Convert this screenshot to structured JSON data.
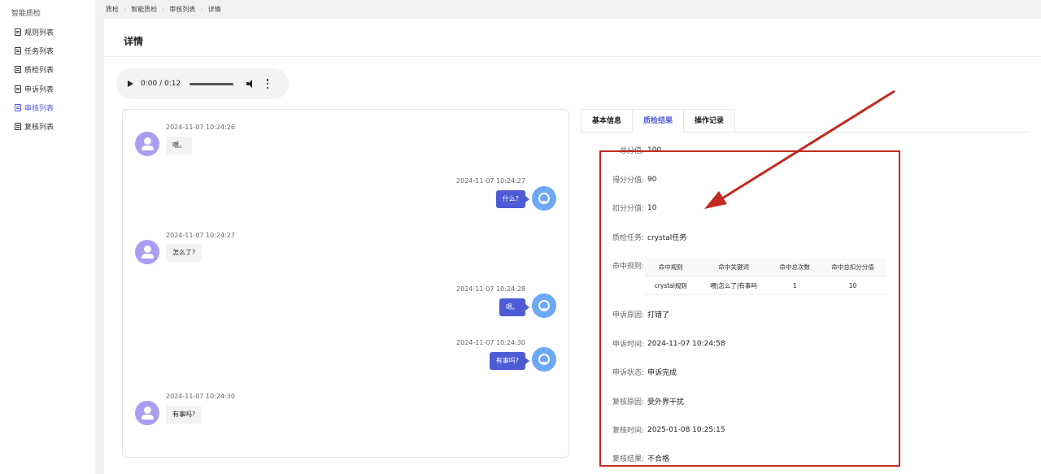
{
  "sidebar": {
    "title": "智能质检",
    "items": [
      {
        "label": "规则列表"
      },
      {
        "label": "任务列表"
      },
      {
        "label": "质检列表"
      },
      {
        "label": "申诉列表"
      },
      {
        "label": "审核列表"
      },
      {
        "label": "复核列表"
      }
    ],
    "active_index": 4
  },
  "breadcrumb": [
    "质检",
    "智能质检",
    "审核列表",
    "详情"
  ],
  "page": {
    "title": "详情"
  },
  "audio": {
    "time": "0:00 / 0:12",
    "progress": 0
  },
  "chat": [
    {
      "role": "user",
      "time": "2024-11-07 10:24:26",
      "text": "喂。"
    },
    {
      "role": "agent",
      "time": "2024-11-07 10:24:27",
      "text": "什么?"
    },
    {
      "role": "user",
      "time": "2024-11-07 10:24:27",
      "text": "怎么了?"
    },
    {
      "role": "agent",
      "time": "2024-11-07 10:24:28",
      "text": "嗯。"
    },
    {
      "role": "agent",
      "time": "2024-11-07 10:24:30",
      "text": "有事吗?"
    },
    {
      "role": "user",
      "time": "2024-11-07 10:24:30",
      "text": "有事吗?"
    }
  ],
  "tabs": [
    {
      "label": "基本信息"
    },
    {
      "label": "质检结果"
    },
    {
      "label": "操作记录"
    }
  ],
  "active_tab": 1,
  "result": {
    "total": {
      "label": "总分值:",
      "value": "100"
    },
    "score": {
      "label": "得分分值:",
      "value": "90"
    },
    "deduct": {
      "label": "扣分分值:",
      "value": "10"
    },
    "task": {
      "label": "质检任务:",
      "value": "crystal任务"
    },
    "rules_label": "命中规则:",
    "rules_headers": [
      "命中规则",
      "命中关键词",
      "命中总次数",
      "命中总扣分分值"
    ],
    "rules_rows": [
      [
        "crystal规则",
        "喂|怎么了|有事吗",
        "1",
        "10"
      ]
    ],
    "appeal_reason": {
      "label": "申诉原因:",
      "value": "打错了"
    },
    "appeal_time": {
      "label": "申诉时间:",
      "value": "2024-11-07 10:24:58"
    },
    "appeal_status": {
      "label": "申诉状态:",
      "value": "申诉完成"
    },
    "review_reason": {
      "label": "复核原因:",
      "value": "受外界干扰"
    },
    "review_time": {
      "label": "复核时间:",
      "value": "2025-01-08 10:25:15"
    },
    "review_result": {
      "label": "复核结果:",
      "value": "不合格"
    }
  },
  "colors": {
    "accent": "#4f5bd5",
    "annotation": "#c22a22"
  }
}
